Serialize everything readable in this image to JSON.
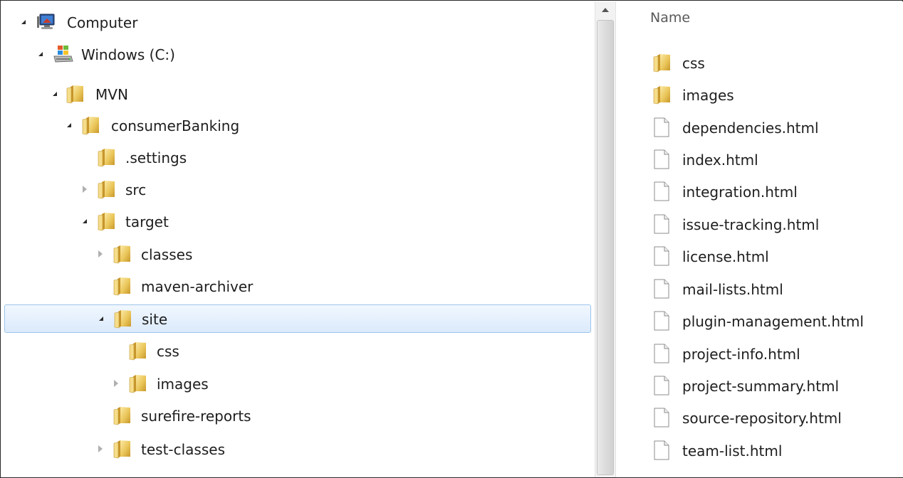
{
  "tree": {
    "items": [
      {
        "label": "Computer",
        "state": "expanded",
        "icon": "computer-icon"
      },
      {
        "label": "Windows (C:)",
        "state": "expanded",
        "icon": "drive-icon"
      },
      {
        "label": "MVN",
        "state": "expanded",
        "icon": "folder-icon"
      },
      {
        "label": "consumerBanking",
        "state": "expanded",
        "icon": "folder-icon"
      },
      {
        "label": ".settings",
        "state": "leaf",
        "icon": "folder-icon"
      },
      {
        "label": "src",
        "state": "collapsed",
        "icon": "folder-icon"
      },
      {
        "label": "target",
        "state": "expanded",
        "icon": "folder-icon"
      },
      {
        "label": "classes",
        "state": "collapsed",
        "icon": "folder-icon"
      },
      {
        "label": "maven-archiver",
        "state": "leaf",
        "icon": "folder-icon"
      },
      {
        "label": "site",
        "state": "expanded",
        "icon": "folder-icon",
        "selected": true
      },
      {
        "label": "css",
        "state": "leaf",
        "icon": "folder-icon"
      },
      {
        "label": "images",
        "state": "collapsed",
        "icon": "folder-icon"
      },
      {
        "label": "surefire-reports",
        "state": "leaf",
        "icon": "folder-icon"
      },
      {
        "label": "test-classes",
        "state": "collapsed",
        "icon": "folder-icon"
      }
    ]
  },
  "list": {
    "column_header": "Name",
    "items": [
      {
        "label": "css",
        "type": "folder"
      },
      {
        "label": "images",
        "type": "folder"
      },
      {
        "label": "dependencies.html",
        "type": "file"
      },
      {
        "label": "index.html",
        "type": "file"
      },
      {
        "label": "integration.html",
        "type": "file"
      },
      {
        "label": "issue-tracking.html",
        "type": "file"
      },
      {
        "label": "license.html",
        "type": "file"
      },
      {
        "label": "mail-lists.html",
        "type": "file"
      },
      {
        "label": "plugin-management.html",
        "type": "file"
      },
      {
        "label": "project-info.html",
        "type": "file"
      },
      {
        "label": "project-summary.html",
        "type": "file"
      },
      {
        "label": "source-repository.html",
        "type": "file"
      },
      {
        "label": "team-list.html",
        "type": "file"
      }
    ]
  },
  "colors": {
    "selection_background": "#dbeafc",
    "selection_border": "#9dc4ec",
    "folder": "#e8c14f",
    "text": "#1e1e1e"
  }
}
